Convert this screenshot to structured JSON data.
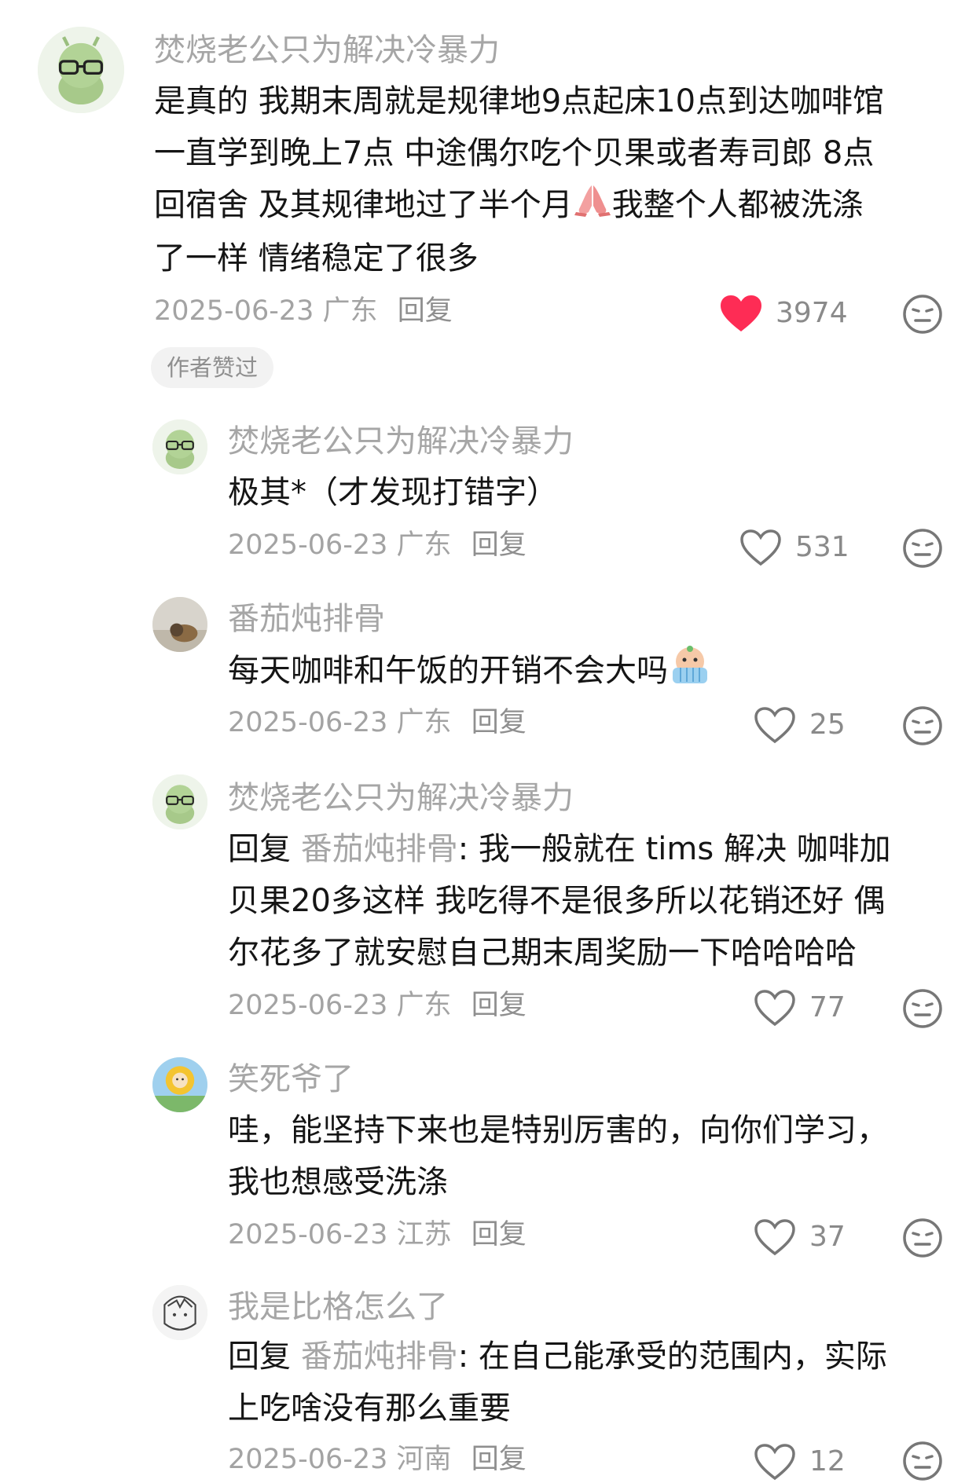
{
  "comments": [
    {
      "author": "焚烧老公只为解决冷暴力",
      "lines": [
        "是真的 我期末周就是规律地9点起床10点到达咖啡馆",
        "一直学到晚上7点 中途偶尔吃个贝果或者寿司郎 8点",
        "回宿舍 及其规律地过了半个月",
        "我整个人都被洗涤",
        "了一样 情绪稳定了很多"
      ],
      "emoji": "pray-hands-emoji",
      "date": "2025-06-23",
      "region": "广东",
      "reply_label": "回复",
      "likes": "3974",
      "liked": true,
      "badge": "作者赞过"
    },
    {
      "author": "焚烧老公只为解决冷暴力",
      "lines": [
        "极其*（才发现打错字）"
      ],
      "date": "2025-06-23",
      "region": "广东",
      "reply_label": "回复",
      "likes": "531"
    },
    {
      "author": "番茄炖排骨",
      "lines": [
        "每天咖啡和午饭的开销不会大吗"
      ],
      "emoji": "crying-baby-emoji",
      "date": "2025-06-23",
      "region": "广东",
      "reply_label": "回复",
      "likes": "25"
    },
    {
      "author": "焚烧老公只为解决冷暴力",
      "reply_prefix": "回复",
      "reply_to": "番茄炖排骨",
      "lines": [
        ": 我一般就在 tims 解决 咖啡加",
        "贝果20多这样 我吃得不是很多所以花销还好 偶",
        "尔花多了就安慰自己期末周奖励一下哈哈哈哈"
      ],
      "date": "2025-06-23",
      "region": "广东",
      "reply_label": "回复",
      "likes": "77"
    },
    {
      "author": "笑死爷了",
      "lines": [
        "哇，能坚持下来也是特别厉害的，向你们学习，",
        "我也想感受洗涤"
      ],
      "date": "2025-06-23",
      "region": "江苏",
      "reply_label": "回复",
      "likes": "37"
    },
    {
      "author": "我是比格怎么了",
      "reply_prefix": "回复",
      "reply_to": "番茄炖排骨",
      "lines": [
        ": 在自己能承受的范围内，实际",
        "上吃啥没有那么重要"
      ],
      "date": "2025-06-23",
      "region": "河南",
      "reply_label": "回复",
      "likes": "12"
    }
  ],
  "colors": {
    "heart_liked": "#fe2c55",
    "muted_text": "#a6a6a6",
    "badge_bg": "#f2f2f2"
  },
  "icons": {
    "like": "heart-icon",
    "dislike": "dislike-face-icon"
  }
}
